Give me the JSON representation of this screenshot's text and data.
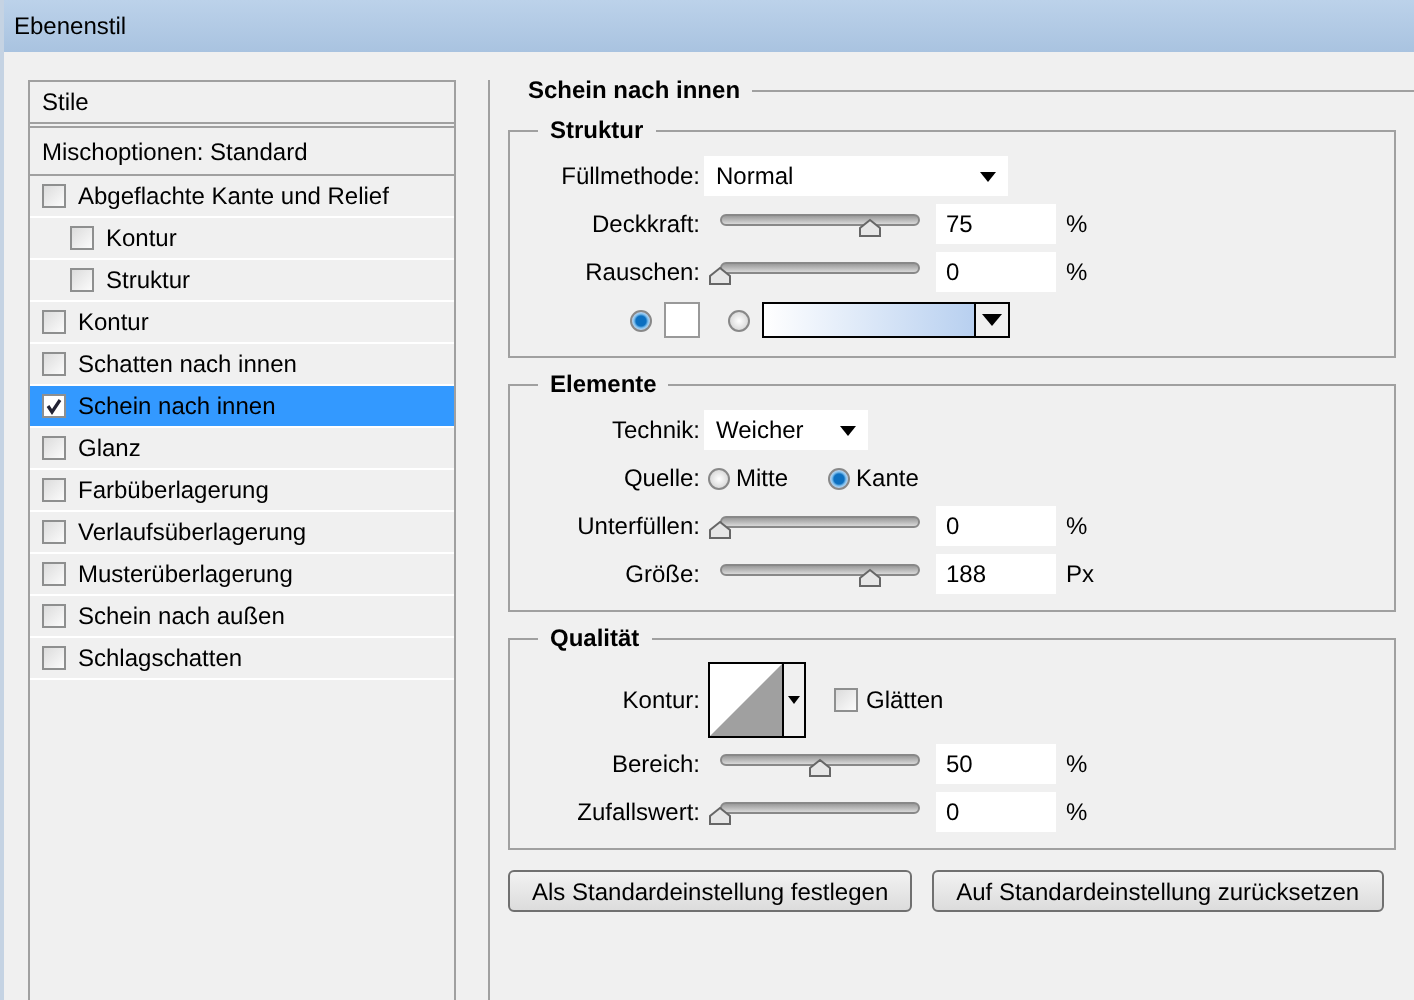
{
  "window": {
    "title": "Ebenenstil"
  },
  "sidebar": {
    "header": "Stile",
    "blend_options": "Mischoptionen: Standard",
    "items": [
      {
        "label": "Abgeflachte Kante und Relief",
        "checked": false,
        "selected": false,
        "children": [
          {
            "label": "Kontur",
            "checked": false,
            "selected": false
          },
          {
            "label": "Struktur",
            "checked": false,
            "selected": false
          }
        ]
      },
      {
        "label": "Kontur",
        "checked": false,
        "selected": false
      },
      {
        "label": "Schatten nach innen",
        "checked": false,
        "selected": false
      },
      {
        "label": "Schein nach innen",
        "checked": true,
        "selected": true
      },
      {
        "label": "Glanz",
        "checked": false,
        "selected": false
      },
      {
        "label": "Farbüberlagerung",
        "checked": false,
        "selected": false
      },
      {
        "label": "Verlaufsüberlagerung",
        "checked": false,
        "selected": false
      },
      {
        "label": "Musterüberlagerung",
        "checked": false,
        "selected": false
      },
      {
        "label": "Schein nach außen",
        "checked": false,
        "selected": false
      },
      {
        "label": "Schlagschatten",
        "checked": false,
        "selected": false
      }
    ]
  },
  "panel": {
    "title": "Schein nach innen",
    "sections": [
      {
        "title": "Struktur",
        "rows": [
          {
            "kind": "dropdown",
            "label": "Füllmethode:",
            "value": "Normal"
          },
          {
            "kind": "slider",
            "label": "Deckkraft:",
            "level": 0.75,
            "value": "75",
            "unit": "%"
          },
          {
            "kind": "slider",
            "label": "Rauschen:",
            "level": 0,
            "value": "0",
            "unit": "%"
          },
          {
            "kind": "fill",
            "options": [
              {
                "kind": "color",
                "selected": true
              },
              {
                "kind": "gradient",
                "selected": false
              }
            ]
          }
        ]
      },
      {
        "title": "Elemente",
        "rows": [
          {
            "kind": "dropdown",
            "label": "Technik:",
            "value": "Weicher"
          },
          {
            "kind": "radios",
            "label": "Quelle:",
            "options": [
              {
                "label": "Mitte",
                "selected": false
              },
              {
                "label": "Kante",
                "selected": true
              }
            ]
          },
          {
            "kind": "slider",
            "label": "Unterfüllen:",
            "level": 0,
            "value": "0",
            "unit": "%"
          },
          {
            "kind": "slider",
            "label": "Größe:",
            "level": 0.75,
            "value": "188",
            "unit": "Px"
          }
        ]
      },
      {
        "title": "Qualität",
        "rows": [
          {
            "kind": "contour",
            "label": "Kontur:",
            "checkbox": {
              "label": "Glätten",
              "checked": false
            }
          },
          {
            "kind": "slider",
            "label": "Bereich:",
            "level": 0.5,
            "value": "50",
            "unit": "%"
          },
          {
            "kind": "slider",
            "label": "Zufallswert:",
            "level": 0,
            "value": "0",
            "unit": "%"
          }
        ]
      }
    ],
    "buttons": [
      "Als Standardeinstellung festlegen",
      "Auf Standardeinstellung zurücksetzen"
    ]
  }
}
